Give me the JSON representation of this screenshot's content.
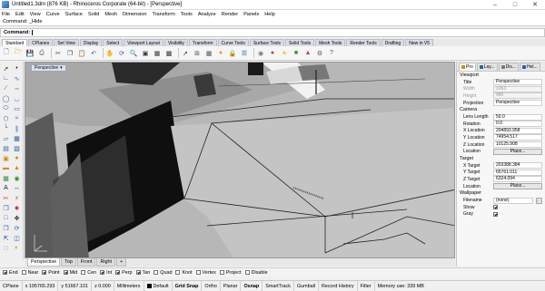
{
  "window": {
    "title": "Untitled1.3dm (876 KB) - Rhinoceros Corporate (64-bit) - [Perspective]"
  },
  "menu": [
    "File",
    "Edit",
    "View",
    "Curve",
    "Surface",
    "Solid",
    "Mesh",
    "Dimension",
    "Transform",
    "Tools",
    "Analyze",
    "Render",
    "Panels",
    "Help"
  ],
  "command": {
    "history": "Command: _Hide",
    "prompt": "Command:"
  },
  "toolbar_tabs": [
    "Standard",
    "CPlanes",
    "Set View",
    "Display",
    "Select",
    "Viewport Layout",
    "Visibility",
    "Transform",
    "Curve Tools",
    "Surface Tools",
    "Solid Tools",
    "Mesh Tools",
    "Render Tools",
    "Drafting",
    "New in V5"
  ],
  "viewport": {
    "label": "Perspective"
  },
  "viewport_tabs": [
    "Perspective",
    "Top",
    "Front",
    "Right"
  ],
  "osnaps": [
    {
      "label": "End",
      "checked": true
    },
    {
      "label": "Near",
      "checked": false
    },
    {
      "label": "Point",
      "checked": true
    },
    {
      "label": "Mid",
      "checked": true
    },
    {
      "label": "Cen",
      "checked": false
    },
    {
      "label": "Int",
      "checked": true
    },
    {
      "label": "Perp",
      "checked": true
    },
    {
      "label": "Tan",
      "checked": true
    },
    {
      "label": "Quad",
      "checked": false
    },
    {
      "label": "Knot",
      "checked": false
    },
    {
      "label": "Vertex",
      "checked": false
    },
    {
      "label": "Project",
      "checked": false
    },
    {
      "label": "Disable",
      "checked": false
    }
  ],
  "status": {
    "cplane": "CPlane",
    "x": "x 195765.293",
    "y": "y 51667.101",
    "z": "z 0.000",
    "units": "Millimeters",
    "layer": "Default",
    "toggles": [
      "Grid Snap",
      "Ortho",
      "Planar",
      "Osnap",
      "SmartTrack",
      "Gumball",
      "Record History",
      "Filter"
    ],
    "memory": "Memory use: 339 MB"
  },
  "panel": {
    "tabs": [
      "Pro",
      "Lay...",
      "Dis...",
      "Hel..."
    ],
    "viewport_section": "Viewport",
    "viewport_rows": [
      {
        "label": "Title",
        "value": "Perspective",
        "dim": false
      },
      {
        "label": "Width",
        "value": "1063",
        "dim": true
      },
      {
        "label": "Height",
        "value": "486",
        "dim": true
      },
      {
        "label": "Projection",
        "value": "Perspective",
        "dim": false
      }
    ],
    "camera_section": "Camera",
    "camera_rows": [
      {
        "label": "Lens Length",
        "value": "50.0"
      },
      {
        "label": "Rotation",
        "value": "0.0"
      },
      {
        "label": "X Location",
        "value": "204893.958"
      },
      {
        "label": "Y Location",
        "value": "74954.517"
      },
      {
        "label": "Z Location",
        "value": "10125.908"
      }
    ],
    "location_label": "Location",
    "place_button": "Place...",
    "target_section": "Target",
    "target_rows": [
      {
        "label": "X Target",
        "value": "203388.384"
      },
      {
        "label": "Y Target",
        "value": "65761.011"
      },
      {
        "label": "Z Target",
        "value": "6324.094"
      }
    ],
    "wallpaper_section": "Wallpaper",
    "filename_label": "Filename",
    "filename_value": "(none)",
    "show_label": "Show",
    "gray_label": "Gray"
  }
}
